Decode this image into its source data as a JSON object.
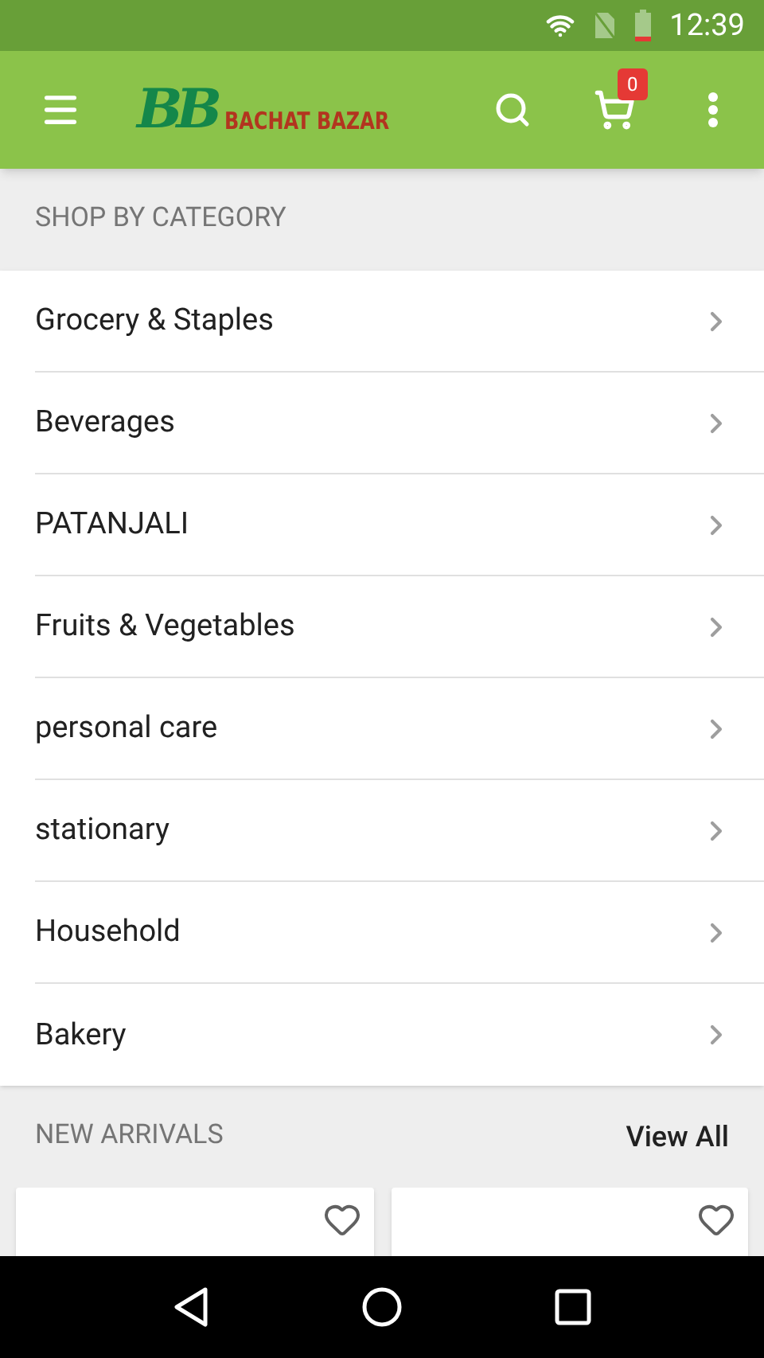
{
  "status_bar": {
    "time": "12:39"
  },
  "app_bar": {
    "logo_mark": "BB",
    "logo_text": "BACHAT BAZAR",
    "cart_count": "0"
  },
  "categories_section": {
    "title": "SHOP BY CATEGORY",
    "items": [
      {
        "label": "Grocery & Staples"
      },
      {
        "label": "Beverages"
      },
      {
        "label": "PATANJALI"
      },
      {
        "label": "Fruits & Vegetables"
      },
      {
        "label": "personal care"
      },
      {
        "label": "stationary"
      },
      {
        "label": "Household"
      },
      {
        "label": "Bakery"
      }
    ]
  },
  "new_arrivals": {
    "title": "NEW ARRIVALS",
    "link": "View All",
    "products": [
      {
        "favorite": false
      },
      {
        "favorite": false
      }
    ]
  }
}
